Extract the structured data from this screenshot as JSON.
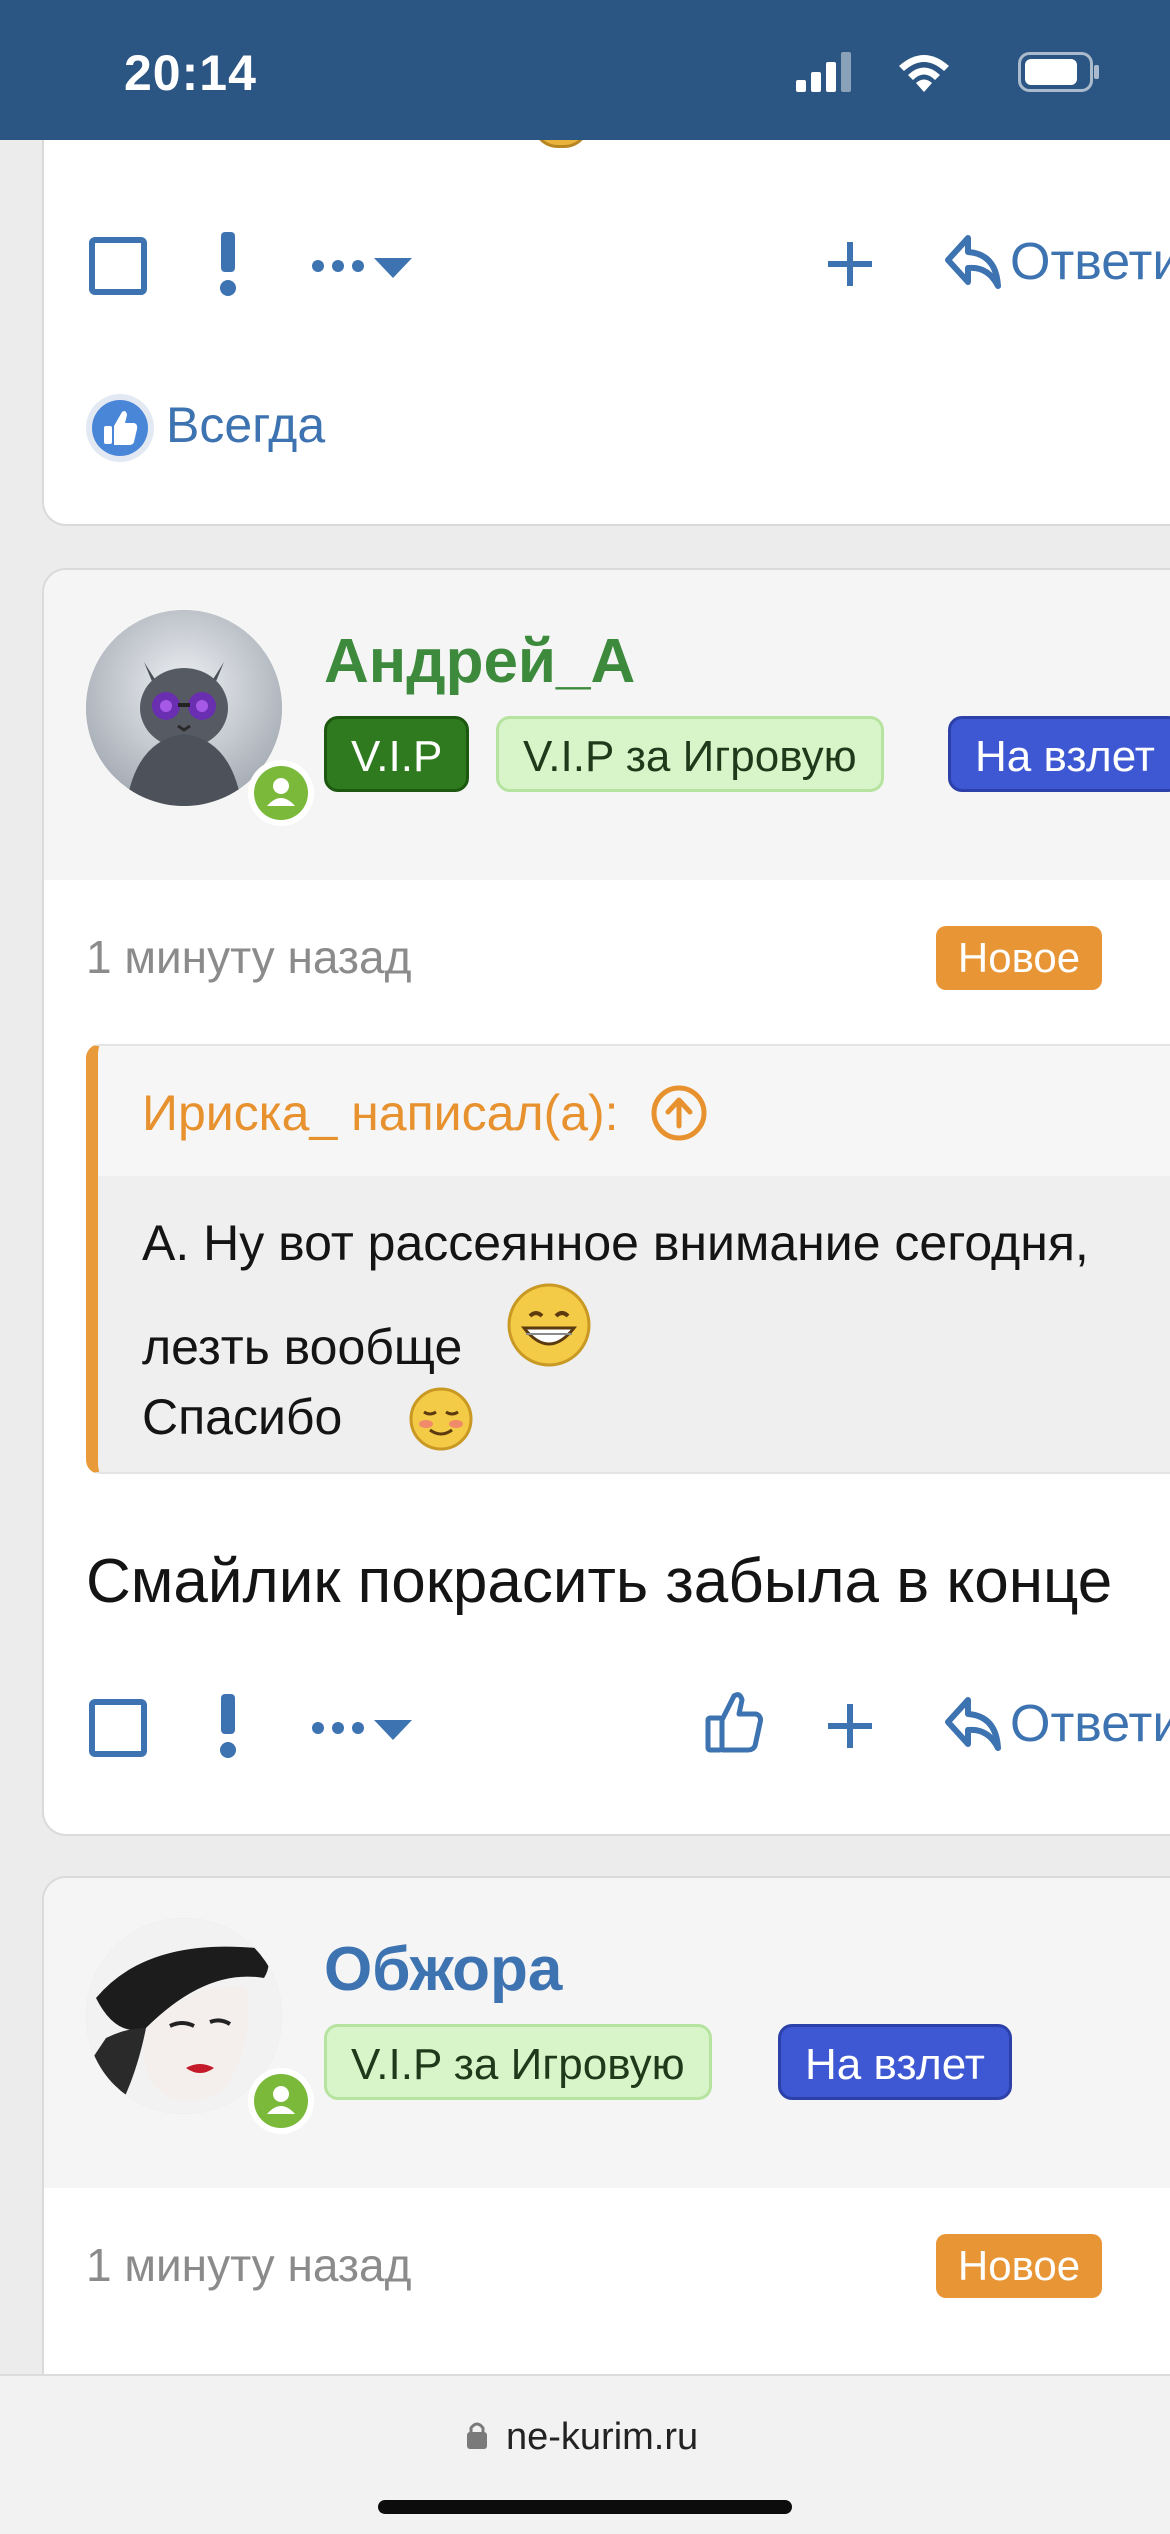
{
  "status_bar": {
    "time": "20:14",
    "battery_level": 0.75
  },
  "colors": {
    "header_blue": "#2b5582",
    "link_blue": "#3d73b0",
    "orange": "#e89536",
    "vip_green": "#2f7a1e",
    "username_green": "#3d8a3c",
    "badge_blue": "#3e57d3"
  },
  "post1": {
    "actions": {
      "select_icon": "checkbox-icon",
      "report_icon": "exclamation-icon",
      "more_icon": "more-dots-caret-icon",
      "quote_icon": "plus-icon",
      "reply_icon": "reply-arrow-icon",
      "reply_label": "Ответи"
    },
    "reaction": {
      "icon": "thumbs-up-icon",
      "label": "Всегда"
    }
  },
  "post2": {
    "username": "Андрей_А",
    "username_color": "#3d8a3c",
    "badges": [
      "V.I.P",
      "V.I.P за Игровую",
      "На взлет"
    ],
    "time": "1 минуту назад",
    "new_label": "Новое",
    "quote": {
      "author": "Ириска_ написал(а):",
      "lines": [
        "А. Ну вот рассеянное внимание сегодня, ",
        "лезть вообще",
        "Спасибо"
      ]
    },
    "text": "Смайлик покрасить забыла в конце",
    "actions": {
      "reply_label": "Ответи"
    }
  },
  "post3": {
    "username": "Обжора",
    "username_color": "#3d73b0",
    "badges": [
      "V.I.P за Игровую",
      "На взлет"
    ],
    "time": "1 минуту назад",
    "new_label": "Новое"
  },
  "browser": {
    "url": "ne-kurim.ru"
  }
}
